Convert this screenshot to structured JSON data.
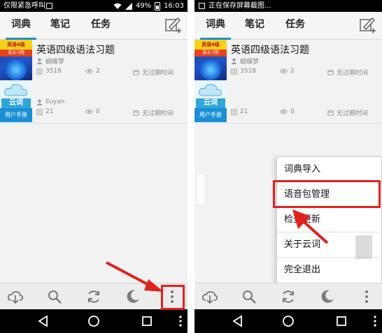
{
  "left": {
    "status": {
      "left_text": "仅限紧急呼叫",
      "battery": "49%",
      "time": "16:03"
    },
    "tabs": [
      "词典",
      "笔记",
      "任务"
    ],
    "books": [
      {
        "title": "英语四级语法习题",
        "author": "蝴蝶梦",
        "count": "3518",
        "views": "2",
        "expiry": "无过期时间",
        "cover_top": "英语4级",
        "cover_sub": "语法习题"
      },
      {
        "title": "",
        "author": "lluyan",
        "count": "21",
        "views": "0",
        "expiry": "无过期时间",
        "cover_name": "云词",
        "cover_footer": "用户手册"
      }
    ]
  },
  "right": {
    "status": {
      "left_text": "正在保存屏幕截图..."
    },
    "tabs": [
      "词典",
      "笔记",
      "任务"
    ],
    "books": [
      {
        "title": "英语四级语法习题",
        "author": "蝴蝶梦",
        "count": "3518",
        "views": "2",
        "expiry": "无过期时间",
        "cover_top": "英语4级",
        "cover_sub": "语法习题"
      },
      {
        "title": "",
        "author": "",
        "count": "21",
        "views": "0",
        "expiry": "无过期时间",
        "cover_name": "云词",
        "cover_footer": "用户手册"
      }
    ],
    "menu": [
      "词典导入",
      "语音包管理",
      "检查更新",
      "关于云词",
      "完全退出"
    ]
  },
  "colors": {
    "accent": "#1a8fd6",
    "highlight": "#e0211b"
  }
}
